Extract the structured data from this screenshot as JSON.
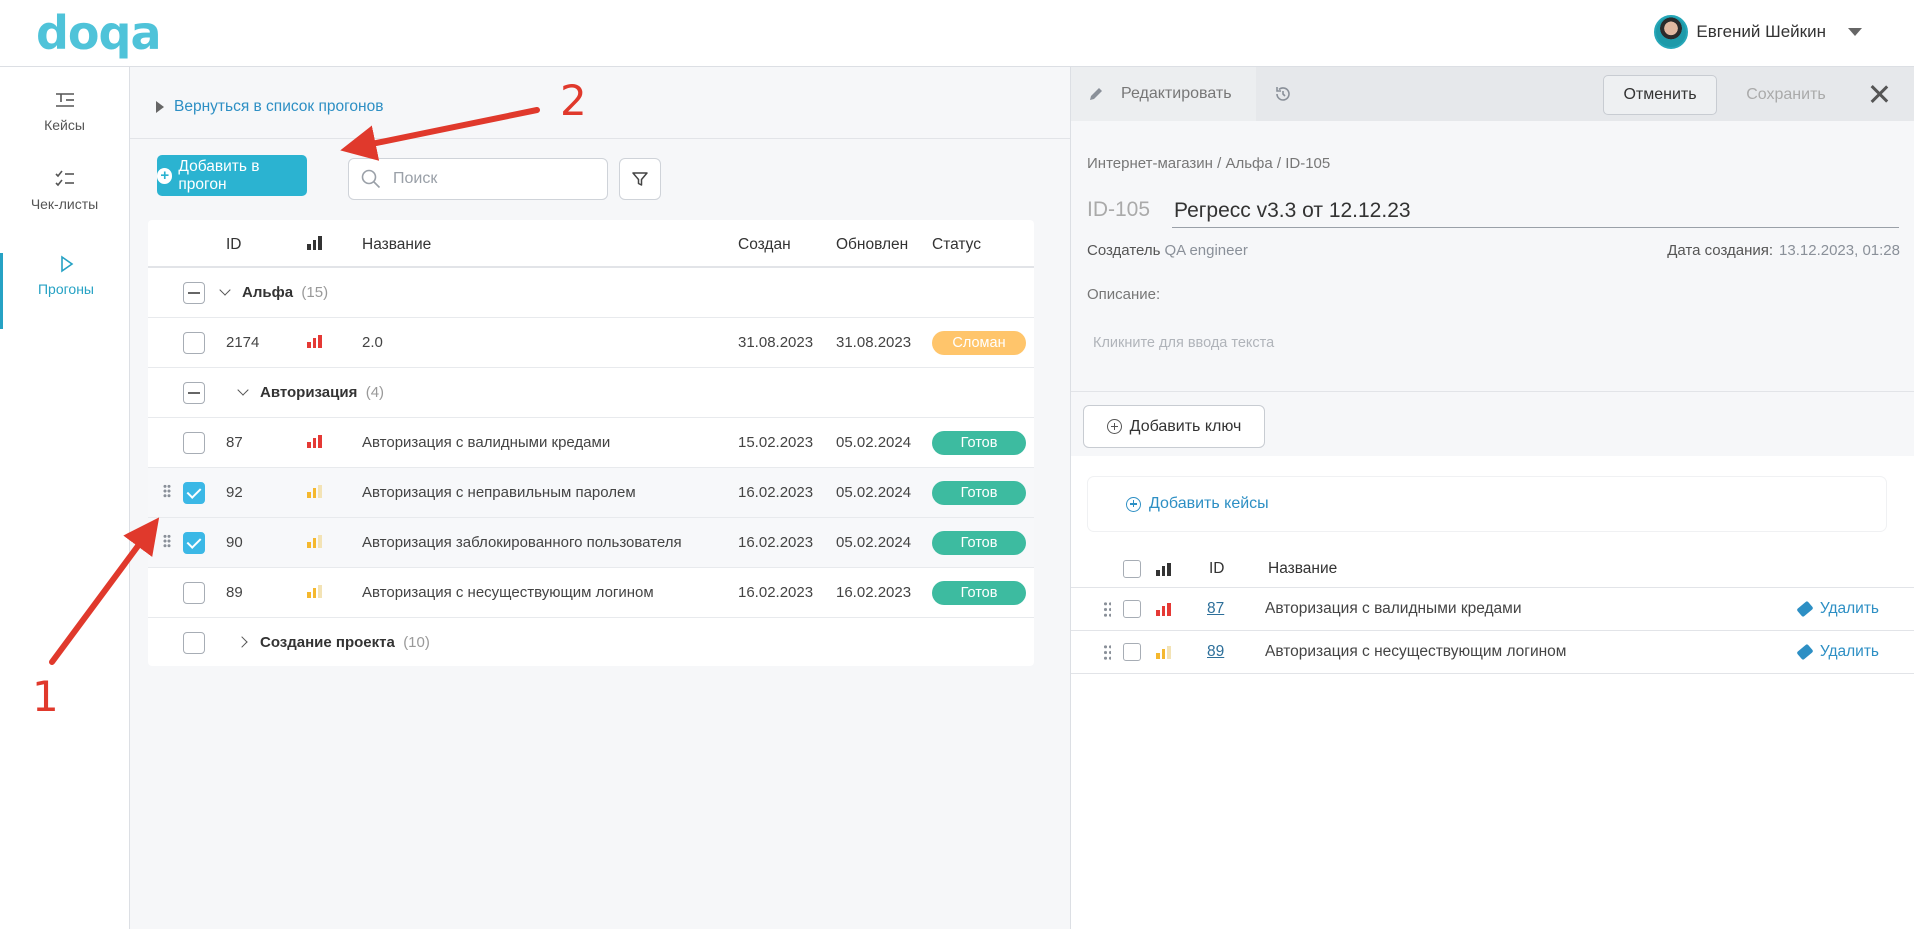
{
  "header": {
    "logo": "doqa",
    "user_name": "Евгений Шейкин"
  },
  "sidebar": {
    "items": [
      {
        "label": "Кейсы",
        "icon": "cases-icon"
      },
      {
        "label": "Чек-листы",
        "icon": "checklist-icon"
      },
      {
        "label": "Прогоны",
        "icon": "play-icon",
        "active": true
      }
    ]
  },
  "main": {
    "back_link": "Вернуться в список прогонов",
    "add_button": "Добавить в прогон",
    "search_placeholder": "Поиск",
    "columns": {
      "id": "ID",
      "name": "Название",
      "created": "Создан",
      "updated": "Обновлен",
      "status": "Статус"
    },
    "groups": [
      {
        "name": "Альфа",
        "count": "(15)"
      },
      {
        "name": "Авторизация",
        "count": "(4)"
      },
      {
        "name": "Создание проекта",
        "count": "(10)"
      }
    ],
    "rows": [
      {
        "id": "2174",
        "name": "2.0",
        "created": "31.08.2023",
        "updated": "31.08.2023",
        "status": "Сломан",
        "priority": "high",
        "checked": false
      },
      {
        "id": "87",
        "name": "Авторизация с валидными кредами",
        "created": "15.02.2023",
        "updated": "05.02.2024",
        "status": "Готов",
        "priority": "high",
        "checked": false
      },
      {
        "id": "92",
        "name": "Авторизация с неправильным паролем",
        "created": "16.02.2023",
        "updated": "05.02.2024",
        "status": "Готов",
        "priority": "medium",
        "checked": true
      },
      {
        "id": "90",
        "name": "Авторизация заблокированного пользователя",
        "created": "16.02.2023",
        "updated": "05.02.2024",
        "status": "Готов",
        "priority": "medium",
        "checked": true
      },
      {
        "id": "89",
        "name": "Авторизация с несуществующим логином",
        "created": "16.02.2023",
        "updated": "16.02.2023",
        "status": "Готов",
        "priority": "medium",
        "checked": false
      }
    ]
  },
  "panel": {
    "edit_tab": "Редактировать",
    "cancel": "Отменить",
    "save": "Сохранить",
    "breadcrumb": "Интернет-магазин / Альфа / ID-105",
    "id": "ID-105",
    "title": "Регресс v3.3 от 12.12.23",
    "creator_label": "Создатель",
    "creator": "QA engineer",
    "date_label": "Дата создания:",
    "date": "13.12.2023, 01:28",
    "description_label": "Описание:",
    "description_placeholder": "Кликните для ввода текста",
    "add_key": "Добавить ключ",
    "add_cases": "Добавить кейсы",
    "columns": {
      "id": "ID",
      "name": "Название"
    },
    "cases": [
      {
        "id": "87",
        "name": "Авторизация с валидными кредами",
        "priority": "high",
        "action": "Удалить"
      },
      {
        "id": "89",
        "name": "Авторизация с несуществующим логином",
        "priority": "medium",
        "action": "Удалить"
      }
    ]
  },
  "annotations": {
    "arrow_1": "1",
    "arrow_2": "2"
  },
  "colors": {
    "accent": "#2bb3d1",
    "status_ready": "#3dbba0",
    "status_broken": "#ffc56b",
    "priority_high": "#e53935",
    "priority_medium": "#f5b82e",
    "annotation": "#e0392c"
  }
}
